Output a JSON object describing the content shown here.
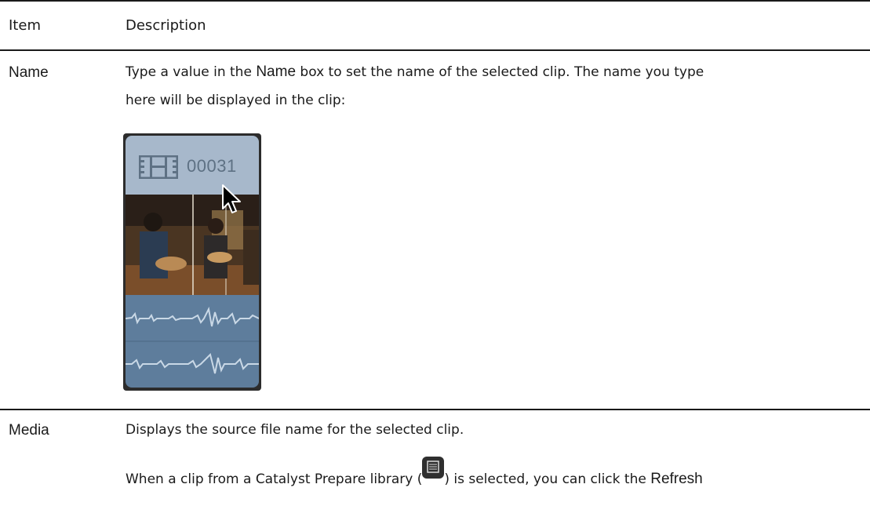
{
  "table": {
    "headers": {
      "item": "Item",
      "description": "Description"
    },
    "rows": [
      {
        "item": "Name",
        "desc_prefix": "Type a value in the ",
        "desc_bold": "Name",
        "desc_suffix": " box to set the name of the selected clip. The name you type",
        "desc_line2": "here will be displayed in the clip:",
        "clip": {
          "title": "00031",
          "icon": "film-strip-icon",
          "cursor": "arrow-cursor-icon",
          "header_color": "#a7b8cb",
          "audio_color": "#5e7d9c"
        }
      },
      {
        "item": "Media",
        "desc_line1": "Displays the source file name for the selected clip.",
        "desc2_prefix": "When a clip from a Catalyst Prepare library (",
        "desc2_icon": "catalyst-library-icon",
        "desc2_middle": ") is selected, you can click the ",
        "desc2_bold": "Refresh"
      }
    ]
  }
}
